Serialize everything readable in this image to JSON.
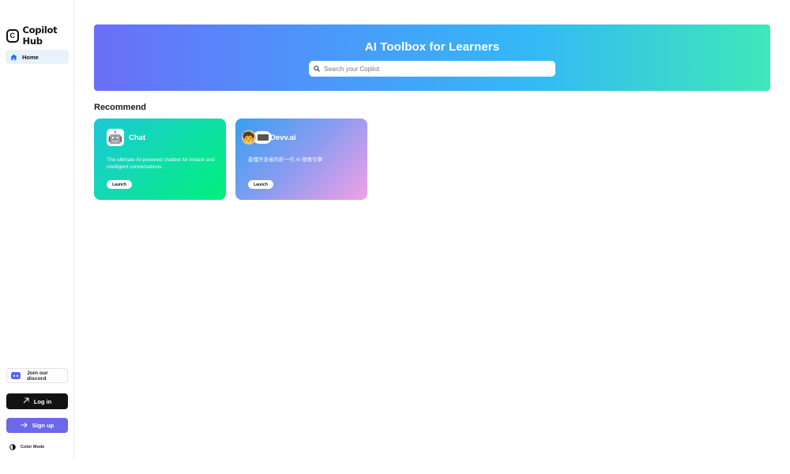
{
  "app": {
    "name": "Copilot Hub",
    "logo_letter": "C"
  },
  "sidebar": {
    "nav": [
      {
        "label": "Home",
        "icon": "home-icon",
        "active": true,
        "accent": "#1a73e8"
      }
    ],
    "discord_label": "Join our discord",
    "login_label": "Log in",
    "signup_label": "Sign up",
    "color_mode_label": "Color Mode"
  },
  "hero": {
    "title": "AI Toolbox for Learners",
    "search_placeholder": "Search your Copilot"
  },
  "main": {
    "section_title": "Recommend",
    "cards": [
      {
        "title": "Chat",
        "icon": "robot-icon",
        "description": "The ultimate AI-powered chatbot for instant and intelligent conversations.",
        "button": "Launch"
      },
      {
        "title": "Devv.ai",
        "icon": "developer-avatar-icon",
        "description": "最懂开发者的新一代 AI 搜索引擎",
        "button": "Launch"
      }
    ]
  },
  "colors": {
    "signup": "#6d67ea",
    "login": "#121212",
    "home_active_bg": "#e8f2fd",
    "discord": "#5865f2"
  }
}
